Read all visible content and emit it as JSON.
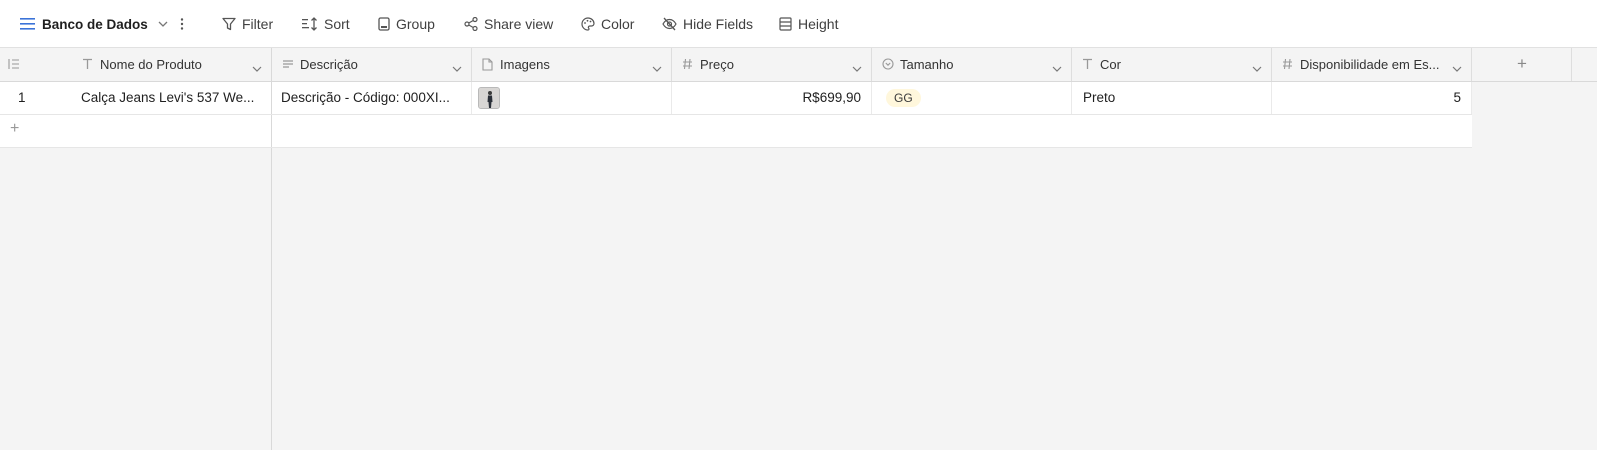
{
  "toolbar": {
    "view_name": "Banco de Dados",
    "filter": "Filter",
    "sort": "Sort",
    "group": "Group",
    "share": "Share view",
    "color": "Color",
    "hide_fields": "Hide Fields",
    "height": "Height"
  },
  "columns": {
    "nome": "Nome do Produto",
    "descricao": "Descrição",
    "imagens": "Imagens",
    "preco": "Preço",
    "tamanho": "Tamanho",
    "cor": "Cor",
    "disponibilidade": "Disponibilidade em Es..."
  },
  "rows": [
    {
      "index": "1",
      "nome": "Calça Jeans Levi's 537 We...",
      "descricao": "Descrição - Código: 000XI...",
      "preco": "R$699,90",
      "tamanho": "GG",
      "cor": "Preto",
      "disponibilidade": "5"
    }
  ],
  "add_row_symbol": "+",
  "add_column_symbol": "+",
  "colors": {
    "accent": "#3b73d8",
    "badge_bg": "#fff7dc",
    "grid_bg": "#f4f4f4"
  },
  "icons": {
    "view": "hamburger-icon",
    "more": "kebab-icon",
    "filter": "funnel-icon",
    "sort": "sort-icon",
    "group": "group-icon",
    "share": "share-icon",
    "color": "palette-icon",
    "hide": "eye-off-icon",
    "height": "row-height-icon"
  }
}
